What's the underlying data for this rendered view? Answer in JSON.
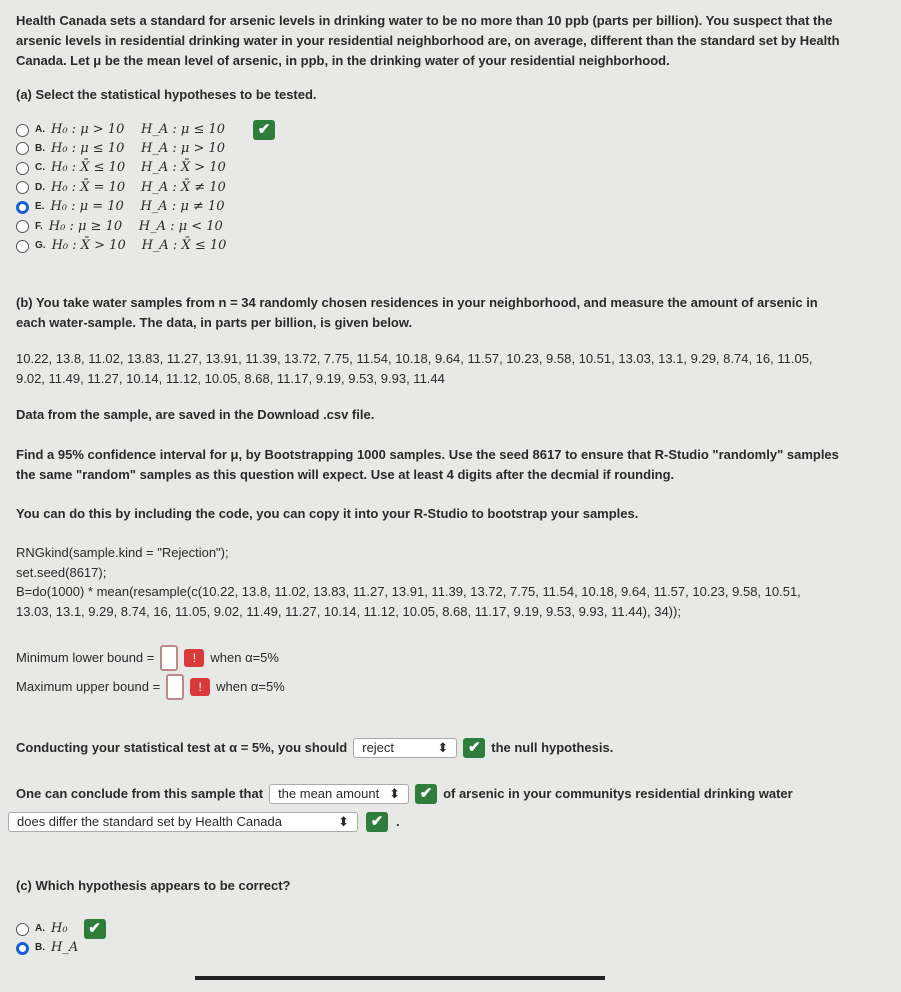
{
  "intro": [
    "Health Canada sets a standard for arsenic levels in drinking water to be no more than 10 ppb (parts per billion). You suspect that the",
    "arsenic levels in residential drinking water in your residential neighborhood are, on average, different than the standard set by Health",
    "Canada. Let μ be the mean level of arsenic, in ppb, in the drinking water of your residential neighborhood."
  ],
  "part_a": {
    "prompt": "(a) Select the statistical hypotheses to be tested.",
    "options": [
      {
        "letter": "A.",
        "h0": "H₀ : μ > 10",
        "ha": "H_A : μ ≤ 10"
      },
      {
        "letter": "B.",
        "h0": "H₀ : μ ≤ 10",
        "ha": "H_A : μ > 10"
      },
      {
        "letter": "C.",
        "h0": "H₀ : X̄ ≤ 10",
        "ha": "H_A : X̄ > 10"
      },
      {
        "letter": "D.",
        "h0": "H₀ : X̄ = 10",
        "ha": "H_A : X̄ ≠ 10"
      },
      {
        "letter": "E.",
        "h0": "H₀ : μ = 10",
        "ha": "H_A : μ ≠ 10"
      },
      {
        "letter": "F.",
        "h0": "H₀ : μ ≥ 10",
        "ha": "H_A : μ < 10"
      },
      {
        "letter": "G.",
        "h0": "H₀ : X̄ > 10",
        "ha": "H_A : X̄ ≤ 10"
      }
    ],
    "selected": "E"
  },
  "part_b": {
    "lines": [
      "(b) You take water samples from n = 34 randomly chosen residences in your neighborhood, and measure the amount of arsenic in",
      "each water-sample. The data, in parts per billion, is given below."
    ],
    "data_lines": [
      "10.22, 13.8, 11.02, 13.83, 11.27, 13.91, 11.39, 13.72, 7.75, 11.54, 10.18, 9.64, 11.57, 10.23, 9.58, 10.51, 13.03, 13.1, 9.29, 8.74, 16, 11.05,",
      "9.02, 11.49, 11.27, 10.14, 11.12, 10.05, 8.68, 11.17, 9.19, 9.53, 9.93, 11.44"
    ],
    "saved": "Data from the sample, are saved in the Download .csv file.",
    "find": [
      "Find a 95% confidence interval for μ, by Bootstrapping 1000 samples. Use the seed 8617 to ensure that R-Studio \"randomly\" samples",
      "the same \"random\" samples as this question will expect. Use at least 4 digits after the decmial if rounding."
    ],
    "code_intro": "You can do this by including the code, you can copy it into your R-Studio to bootstrap your samples.",
    "code": [
      "RNGkind(sample.kind = \"Rejection\");",
      "set.seed(8617);",
      "B=do(1000) * mean(resample(c(10.22, 13.8, 11.02, 13.83, 11.27, 13.91, 11.39, 13.72, 7.75, 11.54, 10.18, 9.64, 11.57, 10.23, 9.58, 10.51,",
      "13.03, 13.1, 9.29, 8.74, 16, 11.05, 9.02, 11.49, 11.27, 10.14, 11.12, 10.05, 8.68, 11.17, 9.19, 9.53, 9.93, 11.44), 34));"
    ],
    "min_label": "Minimum lower bound =",
    "max_label": "Maximum upper bound =",
    "min_value": "",
    "max_value": "",
    "when": "when α=5%",
    "test_pre": "Conducting your statistical test at α = 5%, you should",
    "test_select": "reject",
    "test_post": "the null hypothesis.",
    "conclude_pre": "One can conclude from this sample that",
    "conclude_select": "the mean amount",
    "conclude_post": "of arsenic in your communitys residential drinking water",
    "conclude_select2": "does differ the standard set by Health Canada"
  },
  "part_c": {
    "prompt": "(c) Which hypothesis appears to be correct?",
    "options": [
      {
        "letter": "A.",
        "label": "H₀"
      },
      {
        "letter": "B.",
        "label": "H_A"
      }
    ],
    "selected": "B"
  },
  "colors": {
    "check": "#2e7d3a",
    "error": "#d83a3a",
    "radio_selected": "#1a5fd6"
  }
}
